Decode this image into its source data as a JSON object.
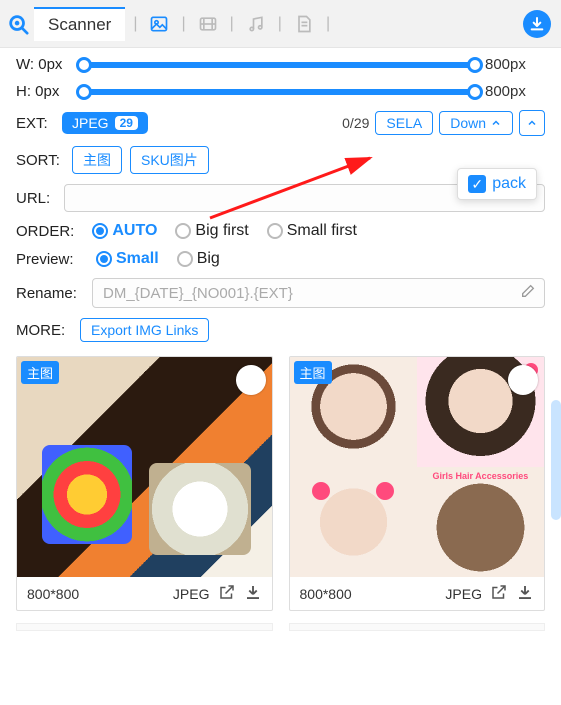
{
  "topbar": {
    "tab": "Scanner"
  },
  "sliders": {
    "w_label": "W: 0px",
    "w_max": "800px",
    "h_label": "H: 0px",
    "h_max": "800px"
  },
  "ext": {
    "label": "EXT:",
    "pill_name": "JPEG",
    "pill_count": "29",
    "counter": "0/29",
    "sela": "SELA",
    "down": "Down"
  },
  "pack": {
    "label": "pack"
  },
  "sort": {
    "label": "SORT:",
    "btn1": "主图",
    "btn2": "SKU图片"
  },
  "url": {
    "label": "URL:"
  },
  "order": {
    "label": "ORDER:",
    "auto": "AUTO",
    "big": "Big first",
    "small": "Small first"
  },
  "preview": {
    "label": "Preview:",
    "small": "Small",
    "big": "Big"
  },
  "rename": {
    "label": "Rename:",
    "placeholder": "DM_{DATE}_{NO001}.{EXT}"
  },
  "more": {
    "label": "MORE:",
    "btn": "Export IMG Links"
  },
  "cards": [
    {
      "badge": "主图",
      "dim": "800*800",
      "ext": "JPEG"
    },
    {
      "badge": "主图",
      "dim": "800*800",
      "ext": "JPEG",
      "overlay": "Girls Hair Accessories"
    }
  ]
}
